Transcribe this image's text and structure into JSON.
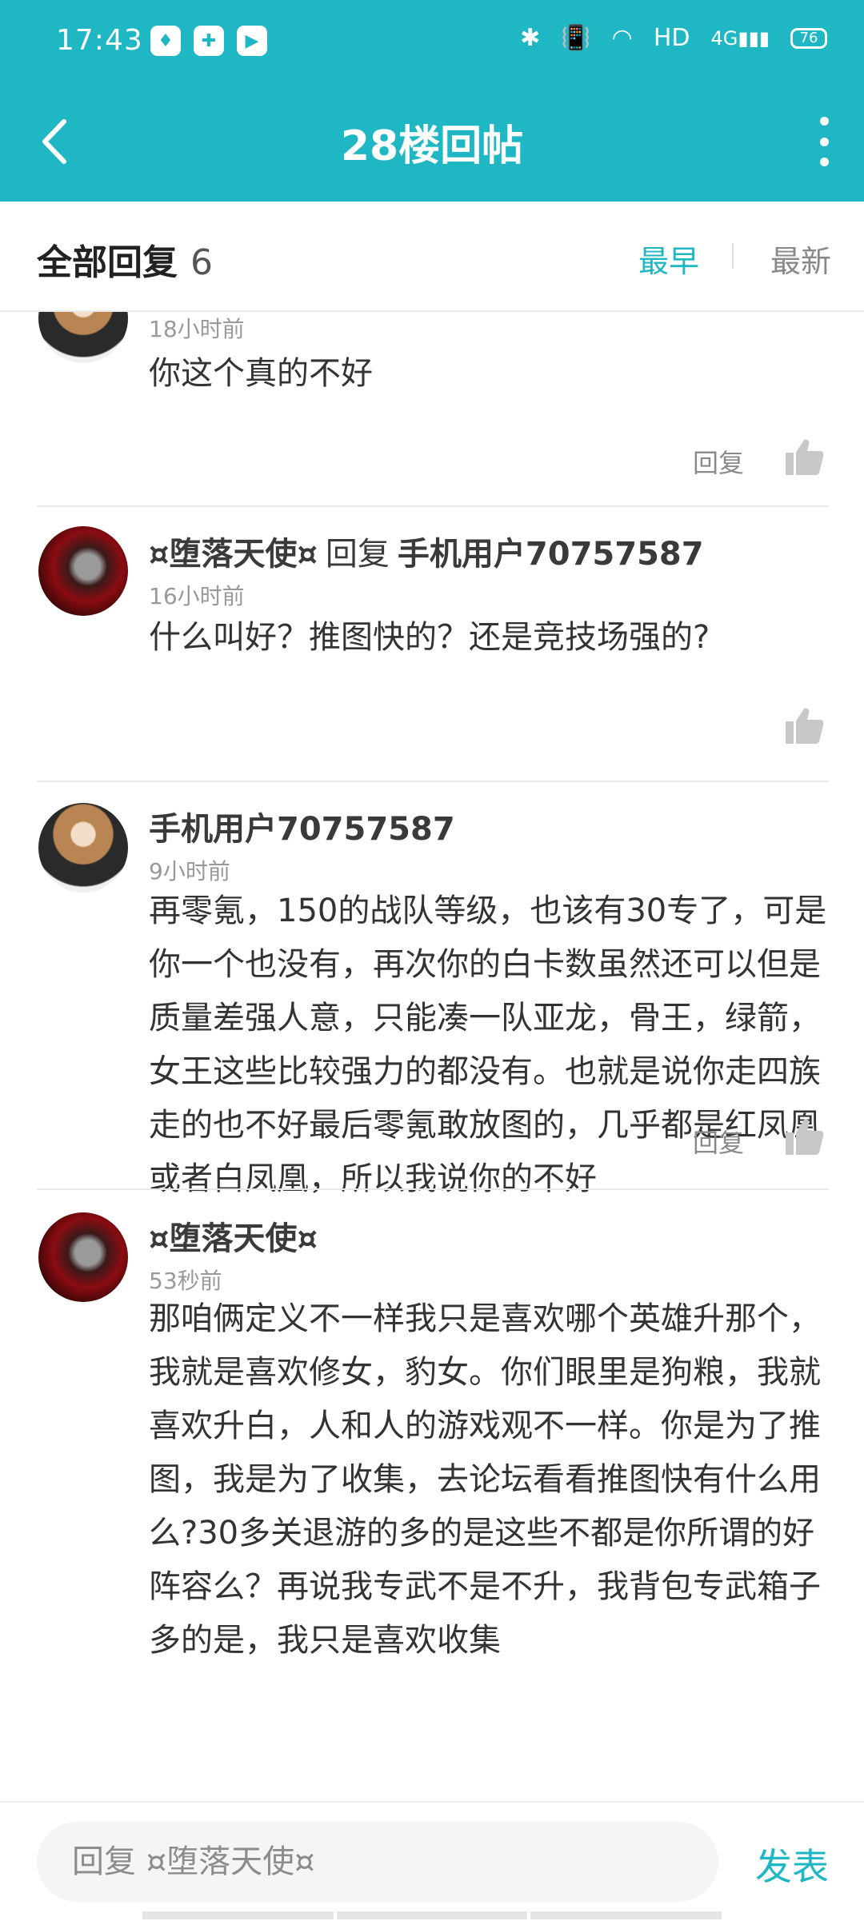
{
  "status_bar": {
    "time": "17:43",
    "network": "HD",
    "signal_label": "4G",
    "battery": "76"
  },
  "nav": {
    "title": "28楼回帖"
  },
  "filter": {
    "all_label": "全部回复",
    "count": "6",
    "earliest": "最早",
    "newest": "最新"
  },
  "comments": [
    {
      "time": "18小时前",
      "content": "你这个真的不好",
      "reply_label": "回复"
    },
    {
      "username": "¤堕落天使¤",
      "reply_word": "回复",
      "reply_target": "手机用户70757587",
      "time": "16小时前",
      "content": "什么叫好？推图快的？还是竞技场强的?"
    },
    {
      "username": "手机用户70757587",
      "time": "9小时前",
      "content": "再零氪，150的战队等级，也该有30专了，可是你一个也没有，再次你的白卡数虽然还可以但是质量差强人意，只能凑一队亚龙，骨王，绿箭，女王这些比较强力的都没有。也就是说你走四族走的也不好最后零氪敢放图的，几乎都是红凤凰或者白凤凰，所以我说你的不好",
      "reply_label": "回复"
    },
    {
      "username": "¤堕落天使¤",
      "time": "53秒前",
      "content": "那咱俩定义不一样我只是喜欢哪个英雄升那个，我就是喜欢修女，豹女。你们眼里是狗粮，我就喜欢升白，人和人的游戏观不一样。你是为了推图，我是为了收集，去论坛看看推图快有什么用么?30多关退游的多的是这些不都是你所谓的好阵容么？再说我专武不是不升，我背包专武箱子多的是，我只是喜欢收集"
    }
  ],
  "bottom": {
    "placeholder": "回复 ¤堕落天使¤",
    "send_label": "发表"
  },
  "colors": {
    "accent": "#1fb7c4"
  }
}
